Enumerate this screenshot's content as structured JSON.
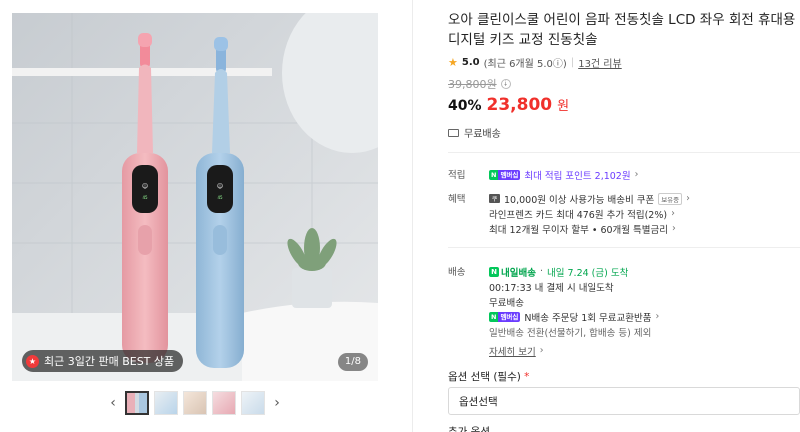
{
  "gallery": {
    "best_badge": "최근 3일간 판매 BEST 상품",
    "page_counter": "1/8",
    "screen_text": "소리세사용"
  },
  "product": {
    "title": "오아 클린이스쿨 어린이 음파 전동칫솔 LCD 좌우 회전 휴대용 디지털 키즈 교정 진동칫솔",
    "rating_score": "5.0",
    "rating_detail": "(최근 6개월 5.0ⓘ)",
    "review_link": "13건 리뷰",
    "original_price": "39,800원",
    "discount": "40%",
    "price": "23,800",
    "price_unit": "원",
    "shipping_summary": "무료배송"
  },
  "benefits": {
    "points_label": "적립",
    "points_badge_n": "N",
    "points_badge_m": "멤버십",
    "points_text": "최대 적립 포인트 2,102원",
    "benefit_label": "혜택",
    "coupon_icon": "쿠",
    "coupon_text": "10,000원 이상 사용가능 배송비 쿠폰",
    "coupon_tag": "보유중",
    "card_text": "라인프렌즈 카드 최대 476원 추가 적립(2%)",
    "installment_text": "최대 12개월 무이자 할부 • 60개월 특별금리"
  },
  "delivery": {
    "label": "배송",
    "today_logo": "내일배송",
    "today_text": "내일 7.24 (금) 도착",
    "cutoff_text": "00:17:33  내 결제 시 내일도착",
    "free_text": "무료배송",
    "npay_text": "N배송 주문당 1회 무료교환반품",
    "general_text": "일반배송 전환(선물하기, 합배송 등) 제외",
    "more_link": "자세히 보기"
  },
  "options": {
    "label": "옵션 선택 (필수)",
    "required_mark": "*",
    "select_value": "옵션선택",
    "next_label": "추가 옵션"
  },
  "colors": {
    "accent_red": "#f0302b",
    "naver_green": "#03c75a",
    "membership_purple": "#6b3cff"
  }
}
